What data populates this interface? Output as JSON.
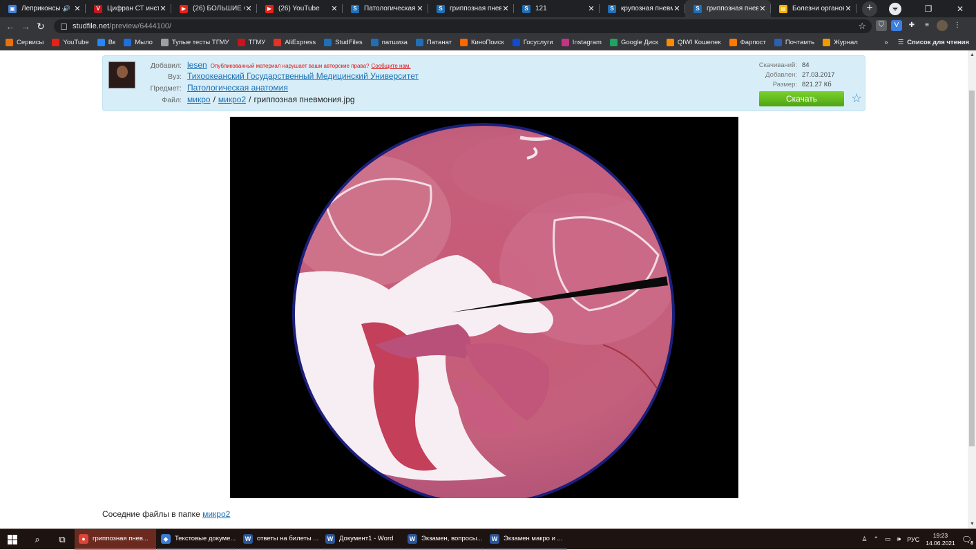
{
  "browser": {
    "tabs": [
      {
        "title": "Леприконсы –",
        "fav_color": "#3d7ee0",
        "fav": "▣",
        "audio": true
      },
      {
        "title": "Цифран СТ инстр",
        "fav_color": "#c4161c",
        "fav": "V"
      },
      {
        "title": "(26) БОЛЬШИЕ СЕ",
        "fav_color": "#e62117",
        "fav": "▶"
      },
      {
        "title": "(26) YouTube",
        "fav_color": "#e62117",
        "fav": "▶"
      },
      {
        "title": "Патологическая а",
        "fav_color": "#1e6fb8",
        "fav": "S"
      },
      {
        "title": "гриппозная пнев",
        "fav_color": "#1e6fb8",
        "fav": "S"
      },
      {
        "title": "121",
        "fav_color": "#1e6fb8",
        "fav": "S"
      },
      {
        "title": "крупозная пневм",
        "fav_color": "#1e6fb8",
        "fav": "S"
      },
      {
        "title": "гриппозная пнев",
        "fav_color": "#1e6fb8",
        "fav": "S",
        "active": true
      },
      {
        "title": "Болезни органов",
        "fav_color": "#f4b400",
        "fav": "▤"
      }
    ],
    "url_host": "studfile.net",
    "url_path": "/preview/6444100/",
    "bookmarks": [
      {
        "label": "Сервисы",
        "color": "#e8710a",
        "icon": "apps-icon"
      },
      {
        "label": "YouTube",
        "color": "#e62117",
        "icon": "youtube-icon"
      },
      {
        "label": "Вк",
        "color": "#2787f5",
        "icon": "vk-icon"
      },
      {
        "label": "Мыло",
        "color": "#1e6fe0",
        "icon": "mail-icon"
      },
      {
        "label": "Тупые тесты ТГМУ",
        "color": "#9aa0a6",
        "icon": "doc-icon"
      },
      {
        "label": "ТГМУ",
        "color": "#c4161c",
        "icon": "tgmu-icon"
      },
      {
        "label": "AliExpress",
        "color": "#e43225",
        "icon": "aliexpress-icon"
      },
      {
        "label": "StudFiles",
        "color": "#1e6fb8",
        "icon": "studfiles-icon"
      },
      {
        "label": "патшиза",
        "color": "#1e6fb8",
        "icon": "studfiles-icon"
      },
      {
        "label": "Патанат",
        "color": "#1e6fb8",
        "icon": "studfiles-icon"
      },
      {
        "label": "КиноПоиск",
        "color": "#ff6600",
        "icon": "kinopoisk-icon"
      },
      {
        "label": "Госуслуги",
        "color": "#0d4cd3",
        "icon": "gosuslugi-icon"
      },
      {
        "label": "Instagram",
        "color": "#c13584",
        "icon": "instagram-icon"
      },
      {
        "label": "Google Диск",
        "color": "#1fa463",
        "icon": "gdrive-icon"
      },
      {
        "label": "QIWI Кошелек",
        "color": "#ff8c00",
        "icon": "qiwi-icon"
      },
      {
        "label": "Фарпост",
        "color": "#ff7a00",
        "icon": "farpost-icon"
      },
      {
        "label": "Почтамть",
        "color": "#2b5fb4",
        "icon": "post-icon"
      },
      {
        "label": "Журнал",
        "color": "#f29900",
        "icon": "journal-icon"
      }
    ],
    "reading_list": "Список для чтения",
    "more": "»"
  },
  "file": {
    "labels": {
      "added_by": "Добавил:",
      "university": "Вуз:",
      "subject": "Предмет:",
      "file": "Файл:"
    },
    "author": "lesen",
    "copyright_text": "Опубликованный материал нарушает ваши авторские права?",
    "copyright_link": "Сообщите нам.",
    "university": "Тихоокеанский Государственный Медицинский Университет",
    "subject": "Патологическая анатомия",
    "path_1": "микро",
    "sep": "/",
    "path_2": "микро2",
    "filename": "гриппозная пневмония.jpg",
    "stats": [
      {
        "k": "Скачиваний:",
        "v": "84"
      },
      {
        "k": "Добавлен:",
        "v": "27.03.2017"
      },
      {
        "k": "Размер:",
        "v": "821.27 Кб"
      }
    ],
    "download": "Скачать"
  },
  "neighbors": {
    "text": "Соседние файлы в папке",
    "link": "микро2"
  },
  "taskbar": {
    "apps": [
      {
        "label": "гриппозная пнев...",
        "color": "#db4437",
        "icon": "chrome-icon",
        "active": true
      },
      {
        "label": "Текстовые докуме...",
        "color": "#3a7bd5",
        "icon": "explorer-icon"
      },
      {
        "label": "ответы на билеты ...",
        "color": "#2b579a",
        "icon": "word-icon"
      },
      {
        "label": "Документ1 - Word",
        "color": "#2b579a",
        "icon": "word-icon"
      },
      {
        "label": "Экзамен, вопросы...",
        "color": "#2b579a",
        "icon": "word-icon"
      },
      {
        "label": "Экзамен макро и ...",
        "color": "#2b579a",
        "icon": "word-icon"
      }
    ],
    "lang": "РУС",
    "time": "19:23",
    "date": "14.06.2021",
    "notif": "8"
  }
}
